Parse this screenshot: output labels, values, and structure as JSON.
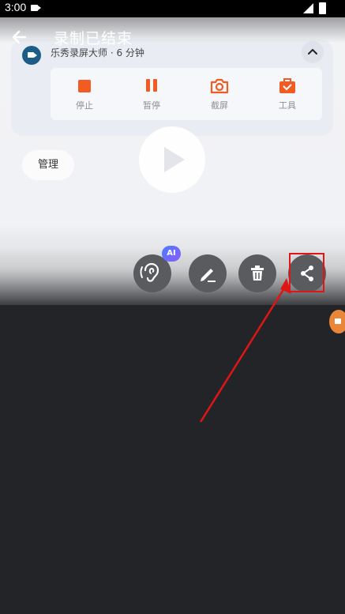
{
  "status_bar": {
    "time": "3:00"
  },
  "header": {
    "title": "录制已结束"
  },
  "recording_card": {
    "app_name": "乐秀录屏大师 · 6 分钟",
    "tools": [
      {
        "label": "停止",
        "icon": "stop-icon"
      },
      {
        "label": "暂停",
        "icon": "pause-icon"
      },
      {
        "label": "截屏",
        "icon": "camera-icon"
      },
      {
        "label": "工具",
        "icon": "toolbox-icon"
      }
    ]
  },
  "manage_label": "管理",
  "actions": {
    "ai_badge": "AI",
    "items": [
      "hearing-icon",
      "edit-icon",
      "delete-icon",
      "share-icon"
    ]
  },
  "colors": {
    "accent": "#f25b22",
    "highlight": "#e01515",
    "background": "#232427"
  }
}
